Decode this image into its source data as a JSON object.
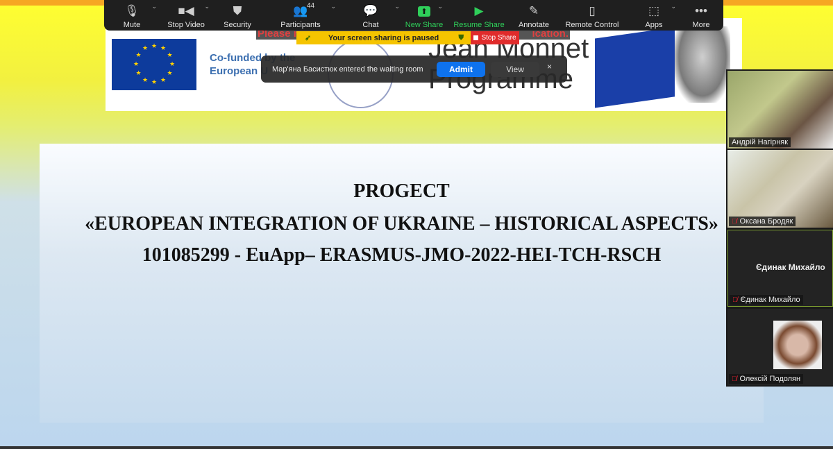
{
  "toolbar": {
    "items": [
      {
        "label": "Mute",
        "icon": "microphone-icon",
        "chevron": true
      },
      {
        "label": "Stop Video",
        "icon": "video-camera-icon",
        "chevron": true
      },
      {
        "label": "Security",
        "icon": "shield-icon",
        "chevron": false
      },
      {
        "label": "Participants",
        "icon": "participants-icon",
        "chevron": true,
        "count": "44"
      },
      {
        "label": "Chat",
        "icon": "chat-icon",
        "chevron": true
      },
      {
        "label": "New Share",
        "icon": "share-arrow-icon",
        "chevron": true,
        "color": "#2fcf5a"
      },
      {
        "label": "Resume Share",
        "icon": "play-icon",
        "chevron": false,
        "color": "#2fcf5a"
      },
      {
        "label": "Annotate",
        "icon": "pencil-icon",
        "chevron": false
      },
      {
        "label": "Remote Control",
        "icon": "mouse-icon",
        "chevron": false
      },
      {
        "label": "Apps",
        "icon": "apps-icon",
        "chevron": true
      },
      {
        "label": "More",
        "icon": "more-dots-icon",
        "chevron": false
      }
    ]
  },
  "share_status": {
    "paused_text": "Your screen sharing is paused",
    "stop_label": "Stop Share"
  },
  "notification": {
    "text": "Мар'яна Басистюк entered the waiting room",
    "admit": "Admit",
    "view": "View",
    "close": "×"
  },
  "banner": {
    "red_left": "Please r",
    "red_right": "ication.",
    "cofunded": "Co-funded by the",
    "european": "European U",
    "jm_line1": "Jean Monnet",
    "jm_line2": "Programme"
  },
  "slide": {
    "line1": "PROGECT",
    "line2": "«EUROPEAN INTEGRATION OF UKRAINE – HISTORICAL ASPECTS»",
    "line3": "101085299 - EuApp– ERASMUS-JMO-2022-HEI-TCH-RSCH"
  },
  "participants": [
    {
      "name": "Андрій Нагірняк",
      "muted": false
    },
    {
      "name": "Оксана Бродяк",
      "muted": true
    },
    {
      "name": "Єдинак Михайло",
      "muted": true,
      "center_name": "Єдинак Михайло"
    },
    {
      "name": "Олексій Подолян",
      "muted": true
    }
  ],
  "colors": {
    "admit": "#0e72ed",
    "paused": "#f5c400",
    "stop": "#e02b2b",
    "share_green": "#2fcf5a"
  }
}
